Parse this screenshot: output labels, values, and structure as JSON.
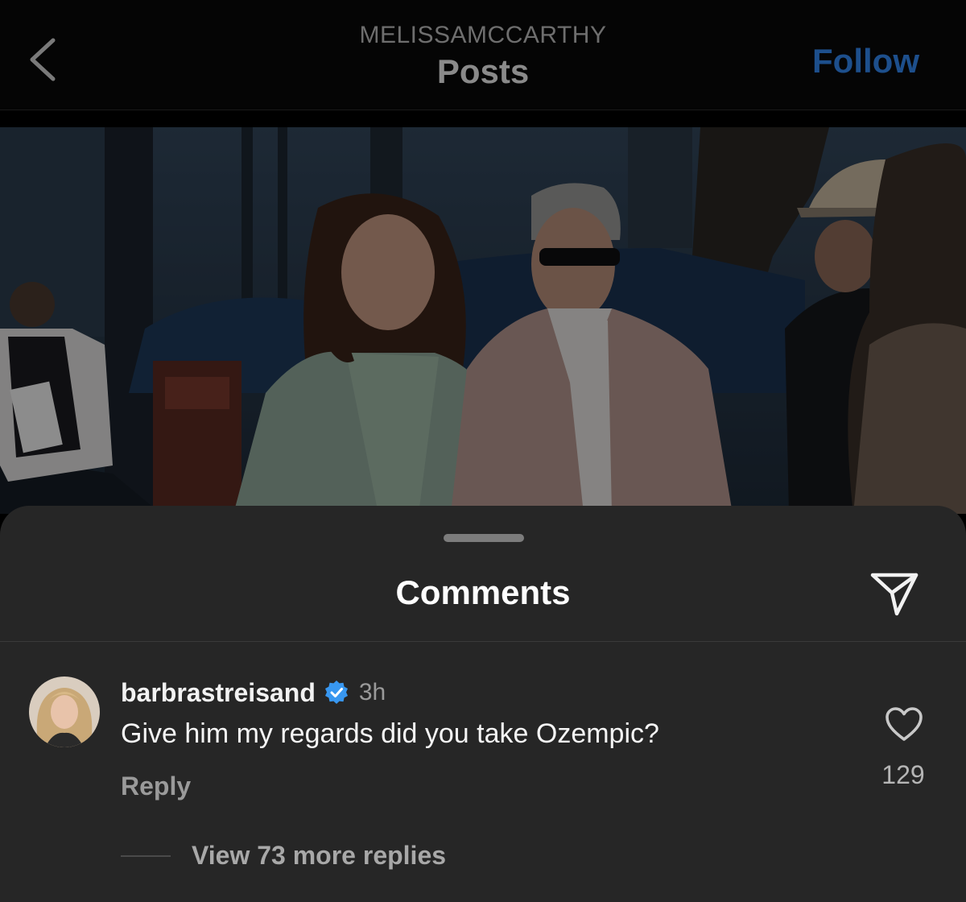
{
  "header": {
    "username": "MELISSAMCCARTHY",
    "title": "Posts",
    "follow_label": "Follow",
    "back_icon": "chevron-left-icon"
  },
  "post": {
    "image_alt": "Photo of a woman with long brown curly hair in a mint green suit and a man in sunglasses wearing a light pink suit, standing outdoors"
  },
  "comments_sheet": {
    "title": "Comments",
    "share_icon": "paper-plane-icon",
    "comments": [
      {
        "username": "barbrastreisand",
        "verified": true,
        "time": "3h",
        "text": "Give him my regards did you take Ozempic?",
        "reply_label": "Reply",
        "like_count": "129",
        "view_replies_label": "View 73 more replies"
      }
    ]
  },
  "colors": {
    "background": "#000000",
    "sheet": "#262626",
    "follow_blue": "#1d4f8c",
    "verified_blue": "#3897f0",
    "text_primary": "#f5f5f5",
    "text_secondary": "#9a9a9a"
  }
}
